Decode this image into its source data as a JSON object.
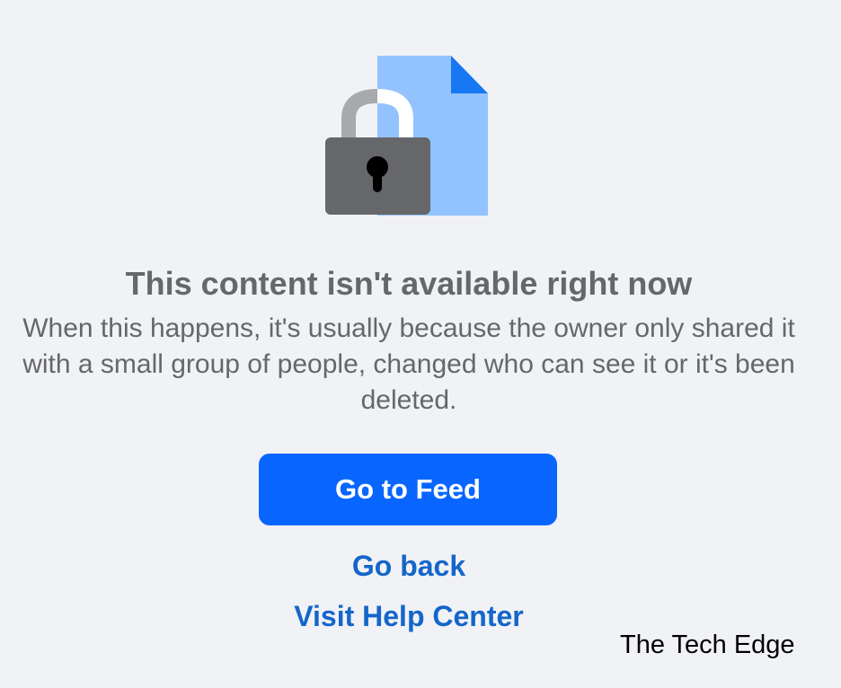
{
  "illustration": {
    "icon": "locked-document-icon",
    "document_color": "#92c3ff",
    "document_fold_color": "#1877f2",
    "lock_body_color": "#65676b",
    "lock_shackle_color": "#a8a9ad"
  },
  "title": "This content isn't available right now",
  "description": "When this happens, it's usually because the owner only shared it with a small group of people, changed who can see it or it's been deleted.",
  "actions": {
    "primary_label": "Go to Feed",
    "back_label": "Go back",
    "help_label": "Visit Help Center"
  },
  "watermark": "The Tech Edge",
  "colors": {
    "background": "#f1f2f6",
    "primary": "#0866ff",
    "link": "#1466c9",
    "text_secondary": "#65676b"
  }
}
